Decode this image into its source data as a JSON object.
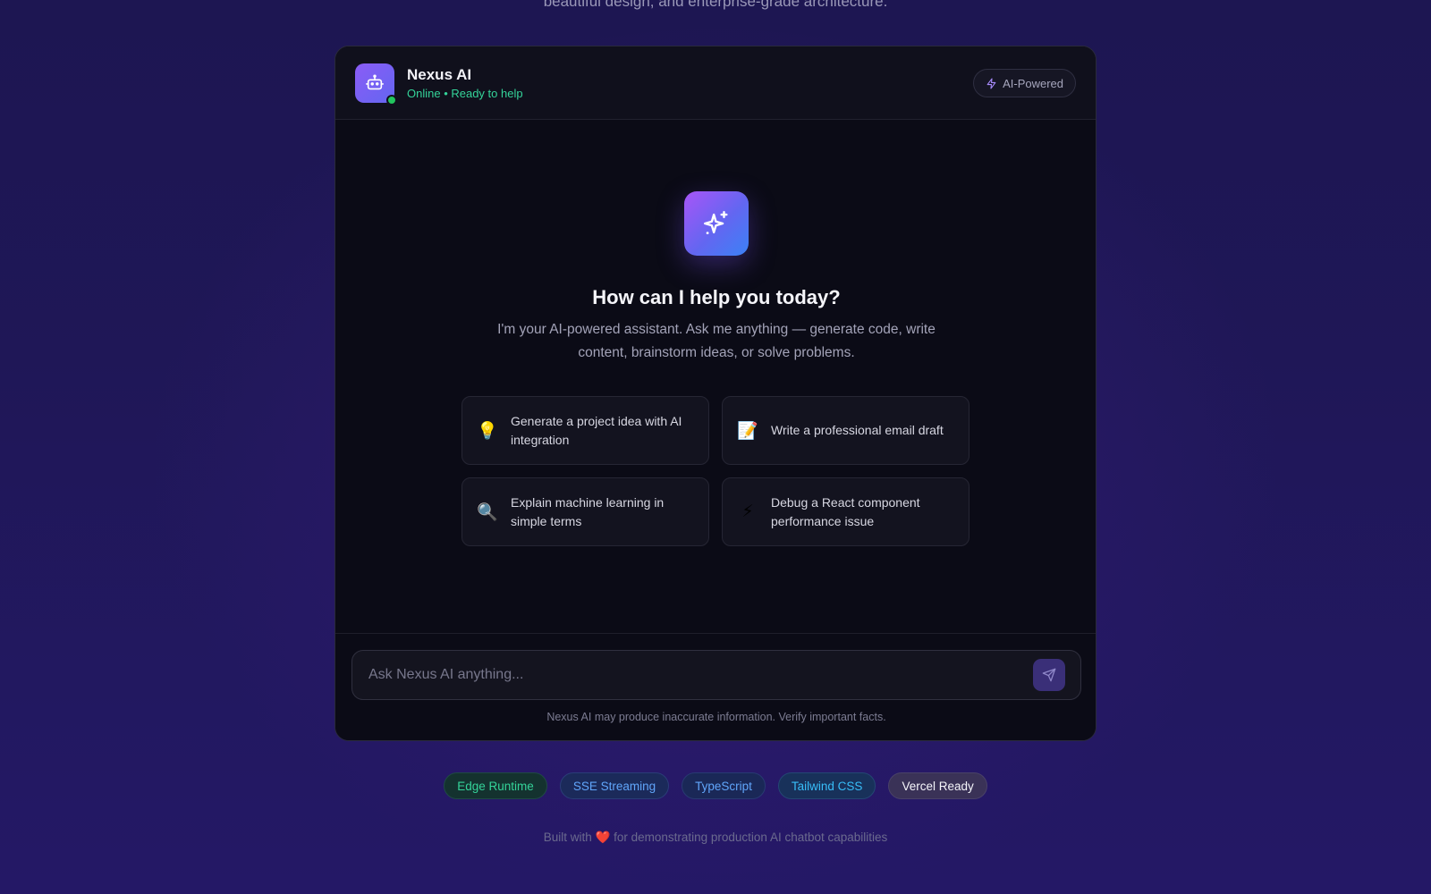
{
  "intro": {
    "text": "beautiful design, and enterprise-grade architecture."
  },
  "header": {
    "bot_name": "Nexus AI",
    "status": "Online • Ready to help",
    "badge_label": "AI-Powered",
    "avatar_icon": "robot-icon",
    "badge_icon": "lightning-icon"
  },
  "welcome": {
    "icon": "sparkles-icon",
    "title": "How can I help you today?",
    "subtitle": "I'm your AI-powered assistant. Ask me anything — generate code, write content, brainstorm ideas, or solve problems."
  },
  "suggestions": [
    {
      "icon": "💡",
      "icon_name": "lightbulb-icon",
      "text": "Generate a project idea with AI integration"
    },
    {
      "icon": "📝",
      "icon_name": "memo-icon",
      "text": "Write a professional email draft"
    },
    {
      "icon": "🔍",
      "icon_name": "magnifier-icon",
      "text": "Explain machine learning in simple terms"
    },
    {
      "icon": "⚡",
      "icon_name": "lightning-icon",
      "text": "Debug a React component performance issue"
    }
  ],
  "input": {
    "placeholder": "Ask Nexus AI anything...",
    "value": "",
    "disclaimer": "Nexus AI may produce inaccurate information. Verify important facts."
  },
  "tech_badges": [
    {
      "label": "Edge Runtime",
      "color": "#34d399",
      "bg": "#14322f",
      "border": "#1f4a44"
    },
    {
      "label": "SSE Streaming",
      "color": "#60a5fa",
      "bg": "#1b2a5a",
      "border": "#2a3d78"
    },
    {
      "label": "TypeScript",
      "color": "#60a5fa",
      "bg": "#1a2857",
      "border": "#283a72"
    },
    {
      "label": "Tailwind CSS",
      "color": "#38bdf8",
      "bg": "#18315a",
      "border": "#244774"
    },
    {
      "label": "Vercel Ready",
      "color": "#f5f5fa",
      "bg": "#3a3257",
      "border": "#4a4268"
    }
  ],
  "footer": {
    "before": "Built with",
    "heart": "❤️",
    "after": "for demonstrating production AI chatbot capabilities"
  },
  "colors": {
    "accent": "#8b5cf6",
    "online": "#34d399",
    "card_bg": "#0b0b16"
  }
}
